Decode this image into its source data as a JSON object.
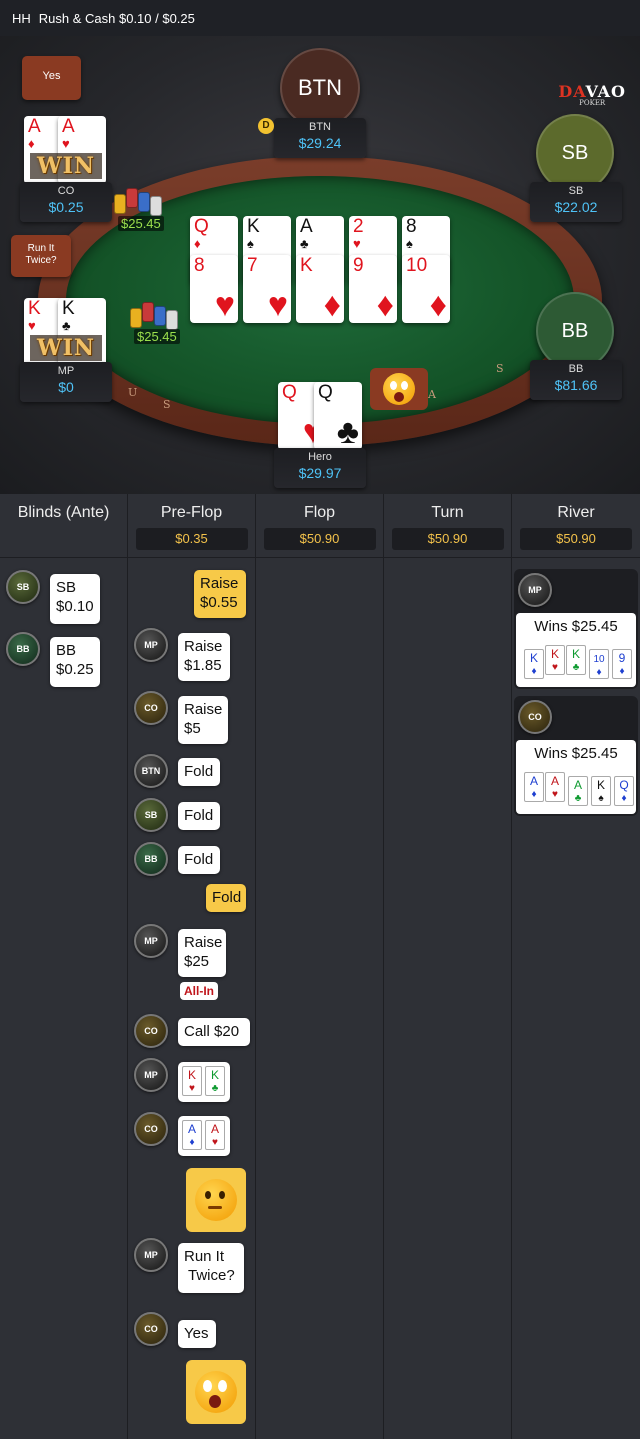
{
  "header": {
    "hh": "HH",
    "title": "Rush & Cash $0.10 / $0.25"
  },
  "logo": {
    "text_a": "D",
    "text_b": "A",
    "text_c": "VAO",
    "sub": "POKER"
  },
  "seats": {
    "btn": {
      "label": "BTN",
      "name": "BTN",
      "stack": "$29.24"
    },
    "sb": {
      "label": "SB",
      "name": "SB",
      "stack": "$22.02"
    },
    "bb": {
      "label": "BB",
      "name": "BB",
      "stack": "$81.66"
    },
    "co": {
      "name": "CO",
      "stack": "$0.25",
      "chat": "Yes",
      "win": "WIN",
      "cards": [
        {
          "rank": "A",
          "suit": "♦"
        },
        {
          "rank": "A",
          "suit": "♥"
        }
      ]
    },
    "mp": {
      "name": "MP",
      "stack": "$0",
      "chat": "Run It Twice?",
      "win": "WIN",
      "cards": [
        {
          "rank": "K",
          "suit": "♥"
        },
        {
          "rank": "K",
          "suit": "♣"
        }
      ]
    },
    "hero": {
      "name": "Hero",
      "stack": "$29.97",
      "cards": [
        {
          "rank": "Q",
          "suit": "♥"
        },
        {
          "rank": "Q",
          "suit": "♣"
        }
      ]
    }
  },
  "dealer_button": "D",
  "pots": {
    "top": "$25.45",
    "bottom": "$25.45"
  },
  "board": {
    "run1": [
      {
        "rank": "Q",
        "suit": "♦"
      },
      {
        "rank": "K",
        "suit": "♠"
      },
      {
        "rank": "A",
        "suit": "♣"
      },
      {
        "rank": "2",
        "suit": "♥"
      },
      {
        "rank": "8",
        "suit": "♠"
      }
    ],
    "run2": [
      {
        "rank": "8",
        "suit": "♥"
      },
      {
        "rank": "7",
        "suit": "♥"
      },
      {
        "rank": "K",
        "suit": "♦"
      },
      {
        "rank": "9",
        "suit": "♦"
      },
      {
        "rank": "10",
        "suit": "♦"
      }
    ]
  },
  "rail_letters": [
    "U",
    "S",
    "A",
    "S"
  ],
  "history": {
    "columns": [
      {
        "title": "Blinds (Ante)",
        "pot": ""
      },
      {
        "title": "Pre-Flop",
        "pot": "$0.35"
      },
      {
        "title": "Flop",
        "pot": "$50.90"
      },
      {
        "title": "Turn",
        "pot": "$50.90"
      },
      {
        "title": "River",
        "pot": "$50.90"
      }
    ],
    "blinds": [
      {
        "player": "SB",
        "line1": "SB",
        "line2": "$0.10"
      },
      {
        "player": "BB",
        "line1": "BB",
        "line2": "$0.25"
      }
    ],
    "preflop": {
      "hero_raise": {
        "line1": "Raise",
        "line2": "$0.55"
      },
      "mp_raise": {
        "player": "MP",
        "line1": "Raise",
        "line2": "$1.85"
      },
      "co_raise": {
        "player": "CO",
        "line1": "Raise",
        "line2": "$5"
      },
      "btn_fold": {
        "player": "BTN",
        "text": "Fold"
      },
      "sb_fold": {
        "player": "SB",
        "text": "Fold"
      },
      "bb_fold": {
        "player": "BB",
        "text": "Fold"
      },
      "hero_fold": {
        "text": "Fold"
      },
      "mp_raise2": {
        "player": "MP",
        "line1": "Raise",
        "line2": "$25",
        "badge": "All-In"
      },
      "co_call": {
        "player": "CO",
        "text": "Call  $20"
      },
      "mp_show": {
        "player": "MP",
        "cards": [
          {
            "rank": "K",
            "suit": "♥"
          },
          {
            "rank": "K",
            "suit": "♣"
          }
        ]
      },
      "co_show": {
        "player": "CO",
        "cards": [
          {
            "rank": "A",
            "suit": "♦"
          },
          {
            "rank": "A",
            "suit": "♥"
          }
        ]
      },
      "mp_chat": {
        "player": "MP",
        "line1": "Run It",
        "line2": "Twice?"
      },
      "co_chat": {
        "player": "CO",
        "text": "Yes"
      }
    },
    "river": [
      {
        "player": "MP",
        "text": "Wins $25.45",
        "cards": [
          {
            "rank": "K",
            "suit": "♦"
          },
          {
            "rank": "K",
            "suit": "♥"
          },
          {
            "rank": "K",
            "suit": "♣"
          },
          {
            "rank": "10",
            "suit": "♦"
          },
          {
            "rank": "9",
            "suit": "♦"
          }
        ]
      },
      {
        "player": "CO",
        "text": "Wins $25.45",
        "cards": [
          {
            "rank": "A",
            "suit": "♦"
          },
          {
            "rank": "A",
            "suit": "♥"
          },
          {
            "rank": "A",
            "suit": "♣"
          },
          {
            "rank": "K",
            "suit": "♠"
          },
          {
            "rank": "Q",
            "suit": "♦"
          }
        ]
      }
    ]
  },
  "colors": {
    "accent_blue": "#4fc3f7",
    "pot_gold": "#f3c24b",
    "chip_green": "#9be04d",
    "hero_bubble": "#f7c948",
    "felt": "#145428"
  }
}
